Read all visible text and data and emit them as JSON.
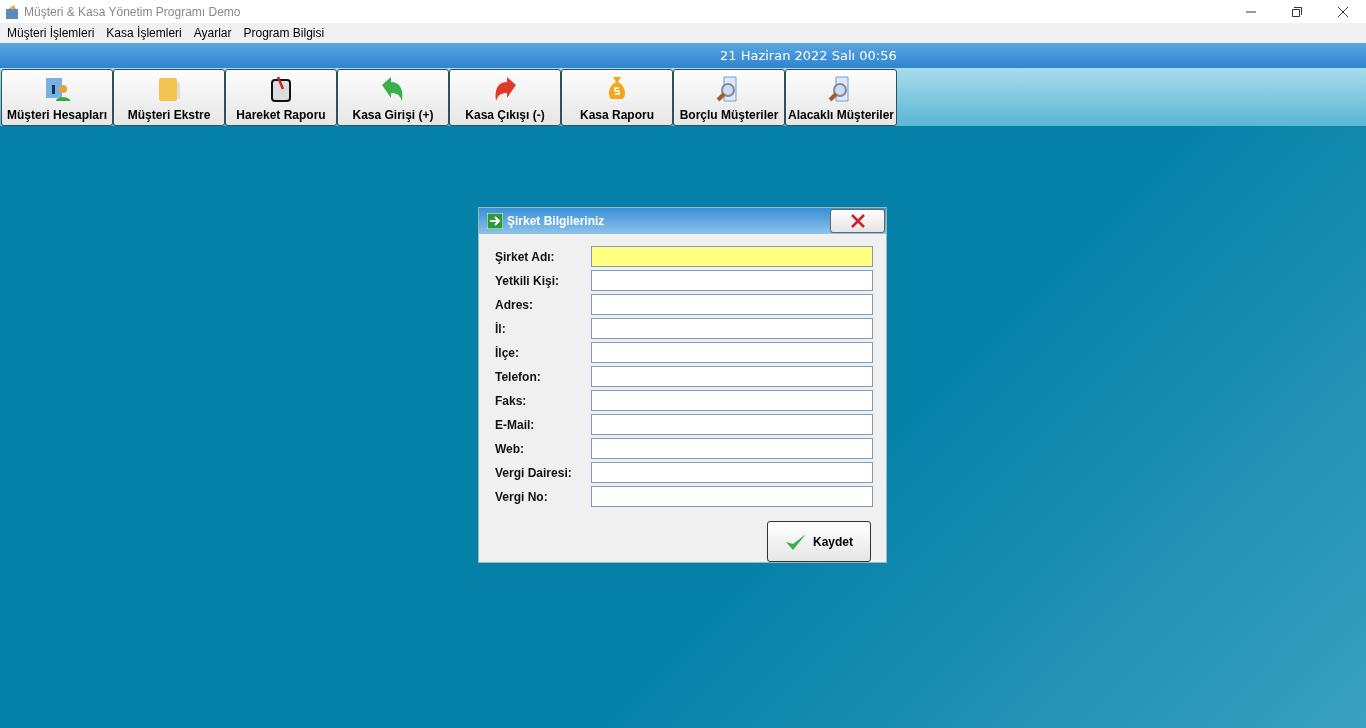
{
  "window": {
    "title": "Müşteri & Kasa Yönetim Programı Demo"
  },
  "menu": [
    "Müşteri İşlemleri",
    "Kasa İşlemleri",
    "Ayarlar",
    "Program Bilgisi"
  ],
  "banner": {
    "datetime": "21 Haziran 2022 Salı 00:56"
  },
  "toolbar": [
    {
      "label": "Müşteri Hesapları",
      "kind": "info"
    },
    {
      "label": "Müşteri Ekstre",
      "kind": "folder"
    },
    {
      "label": "Hareket Raporu",
      "kind": "clip"
    },
    {
      "label": "Kasa Girişi (+)",
      "kind": "in"
    },
    {
      "label": "Kasa Çıkışı (-)",
      "kind": "out"
    },
    {
      "label": "Kasa Raporu",
      "kind": "money"
    },
    {
      "label": "Borçlu Müşteriler",
      "kind": "search"
    },
    {
      "label": "Alacaklı Müşteriler",
      "kind": "search"
    }
  ],
  "dialog": {
    "title": "Şirket Bilgileriniz",
    "fields": [
      {
        "label": "Şirket Adı:",
        "focused": true
      },
      {
        "label": "Yetkili Kişi:",
        "focused": false
      },
      {
        "label": "Adres:",
        "focused": false
      },
      {
        "label": "İl:",
        "focused": false
      },
      {
        "label": "İlçe:",
        "focused": false
      },
      {
        "label": "Telefon:",
        "focused": false
      },
      {
        "label": "Faks:",
        "focused": false
      },
      {
        "label": "E-Mail:",
        "focused": false
      },
      {
        "label": "Web:",
        "focused": false
      },
      {
        "label": "Vergi Dairesi:",
        "focused": false
      },
      {
        "label": "Vergi No:",
        "focused": false
      }
    ],
    "save_button": "Kaydet"
  }
}
